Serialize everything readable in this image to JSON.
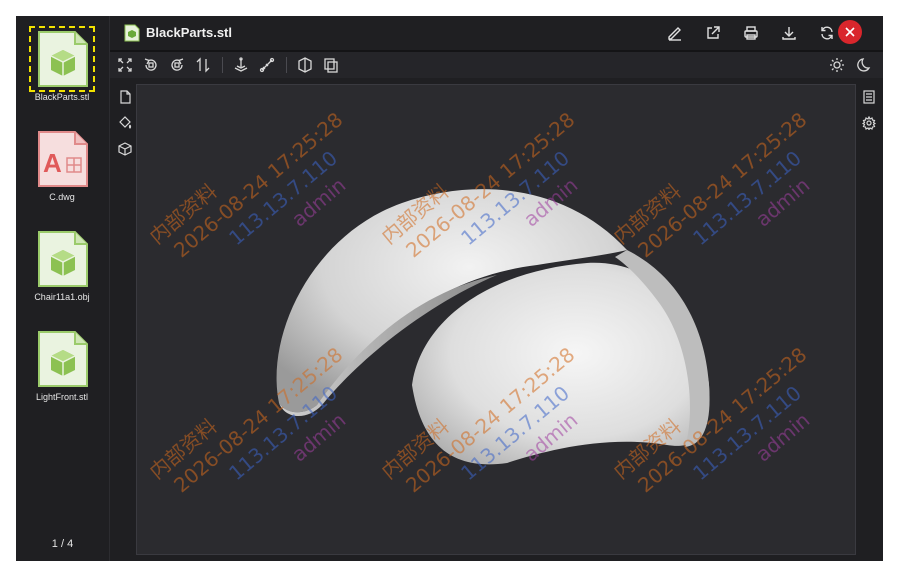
{
  "app": {
    "file_title": "BlackParts.stl"
  },
  "thumbnails": [
    {
      "label": "BlackParts.stl",
      "type": "model",
      "active": true
    },
    {
      "label": "C.dwg",
      "type": "dwg",
      "active": false
    },
    {
      "label": "Chair11a1.obj",
      "type": "model",
      "active": false
    },
    {
      "label": "LightFront.stl",
      "type": "model",
      "active": false
    }
  ],
  "pager": {
    "text": "1 / 4"
  },
  "header_actions": [
    "pencil-icon",
    "external-link-icon",
    "printer-icon",
    "download-icon",
    "refresh-icon",
    "close-icon"
  ],
  "toolbar": {
    "left": [
      "fit-view-icon",
      "rotate-left-icon",
      "rotate-right-icon",
      "flip-vertical-icon",
      "axis-anchor-icon",
      "measure-icon",
      "section-icon",
      "explode-view-icon"
    ],
    "right": [
      "brightness-icon",
      "dark-mode-icon"
    ]
  },
  "left_tools": [
    "document-icon",
    "paint-bucket-icon",
    "cube-icon"
  ],
  "right_tools": [
    "list-panel-icon",
    "settings-icon"
  ],
  "watermark": {
    "line1": "内部资料",
    "line2": "2026-08-24 17:25:28",
    "line3": "113.13.7.110",
    "line4": "admin"
  },
  "colors": {
    "accent_close": "#d9262c",
    "watermark_orange": "#d2691e",
    "watermark_blue": "#3c64c8",
    "watermark_purple": "#a040a0",
    "thumb_highlight": "#f2e200"
  }
}
